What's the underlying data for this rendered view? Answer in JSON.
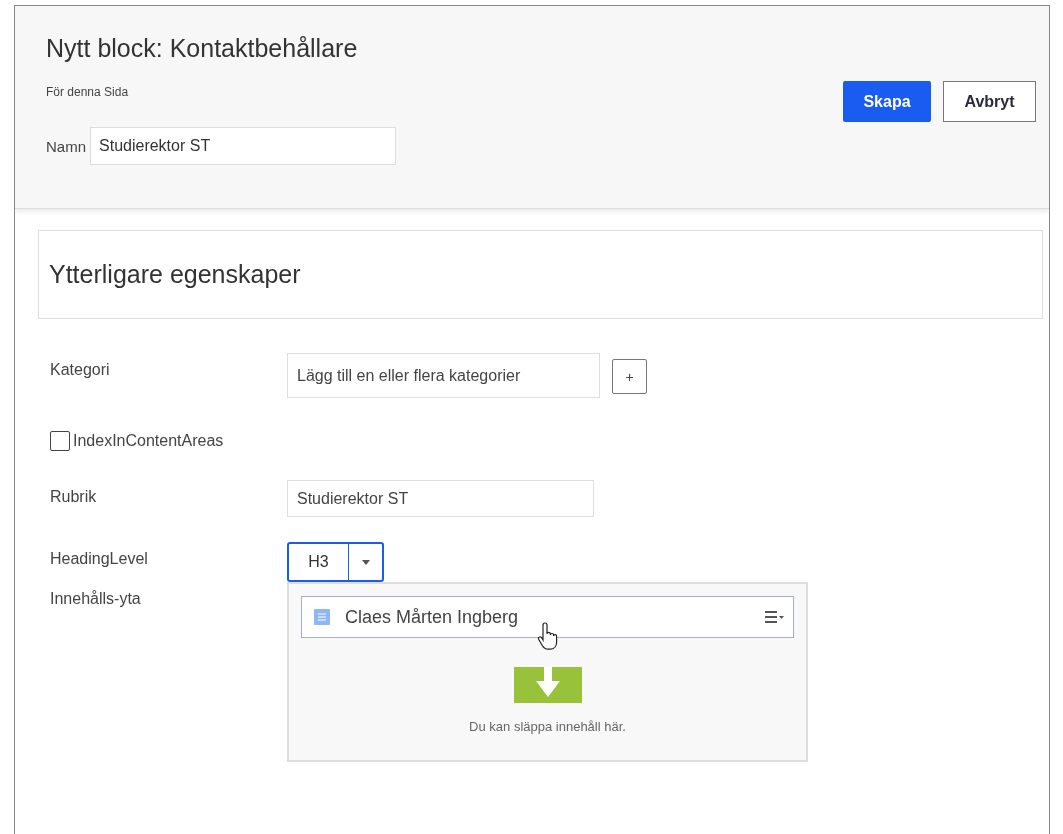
{
  "dialog": {
    "title": "Nytt block: Kontaktbehållare",
    "subtitle": "För denna Sida",
    "name_label": "Namn",
    "name_value": "Studierektor ST",
    "buttons": [
      {
        "label": "Skapa",
        "kind": "primary"
      },
      {
        "label": "Avbryt",
        "kind": "secondary"
      }
    ]
  },
  "section": {
    "title": "Ytterligare egenskaper"
  },
  "fields": [
    {
      "kind": "tags",
      "label": "Kategori",
      "value": "Lägg till en eller flera kategorier",
      "button": "+"
    },
    {
      "kind": "checkbox",
      "label": "IndexInContentAreas",
      "checked": false
    },
    {
      "kind": "text",
      "label": "Rubrik",
      "value": "Studierektor ST"
    },
    {
      "kind": "select",
      "label": "HeadingLevel",
      "value": "H3"
    },
    {
      "kind": "content_area",
      "label": "Innehålls-yta",
      "items": [
        {
          "title": "Claes Mårten Ingberg"
        }
      ],
      "drop_hint": "Du kan släppa innehåll här."
    }
  ]
}
